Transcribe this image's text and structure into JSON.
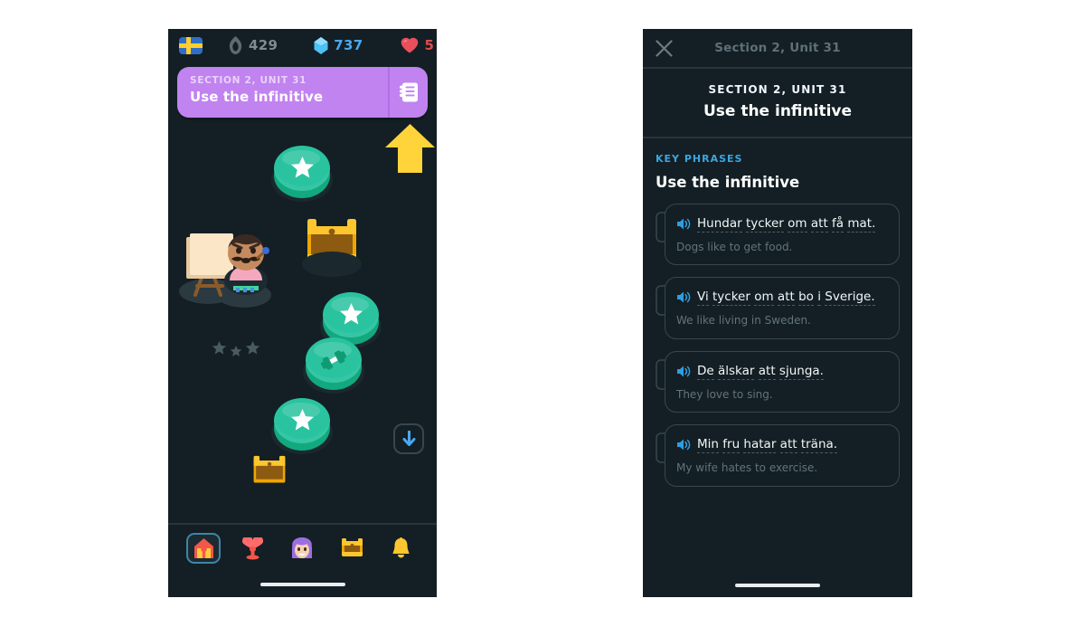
{
  "left_phone": {
    "status_bar": {
      "flag": {
        "icon": "swedish-flag-icon",
        "alt": "Swedish flag"
      },
      "streak": {
        "icon": "flame-icon",
        "value": "429"
      },
      "gems": {
        "icon": "gem-icon",
        "value": "737"
      },
      "hearts": {
        "icon": "heart-icon",
        "value": "5"
      }
    },
    "unit_banner": {
      "subtitle": "SECTION 2, UNIT 31",
      "title": "Use the infinitive",
      "guidebook_icon": "notebook-icon",
      "color": "#c183f0"
    },
    "pointer_arrow": {
      "icon": "up-arrow-icon",
      "color": "#ffd43b"
    },
    "path_nodes": [
      {
        "name": "lesson-node-star-1",
        "glyph": "star-icon",
        "state": "active"
      },
      {
        "name": "chest-node-1",
        "glyph": "treasure-chest-icon",
        "state": "locked"
      },
      {
        "name": "lesson-node-star-2",
        "glyph": "star-icon",
        "state": "locked"
      },
      {
        "name": "lesson-node-dumbbell",
        "glyph": "dumbbell-icon",
        "state": "locked"
      },
      {
        "name": "lesson-node-star-3",
        "glyph": "star-icon",
        "state": "locked"
      },
      {
        "name": "chest-node-2",
        "glyph": "treasure-chest-icon",
        "state": "locked"
      }
    ],
    "mascot": {
      "name": "painter-character",
      "alt": "character at easel"
    },
    "jump_button": {
      "icon": "down-arrow-icon",
      "color": "#49a8f2"
    },
    "nav_items": [
      {
        "name": "nav-learn",
        "icon": "home-icon",
        "active": true
      },
      {
        "name": "nav-practice",
        "icon": "heart-dumbbell-icon",
        "active": false
      },
      {
        "name": "nav-profile",
        "icon": "avatar-icon",
        "active": false
      },
      {
        "name": "nav-quests",
        "icon": "chest-icon",
        "active": false
      },
      {
        "name": "nav-leaderboard",
        "icon": "bell-icon",
        "active": false
      }
    ]
  },
  "right_phone": {
    "topbar": {
      "close_icon": "close-icon",
      "title": "Section 2, Unit 31"
    },
    "header": {
      "subtitle": "SECTION 2, UNIT 31",
      "title": "Use the infinitive"
    },
    "key_phrases_label": "KEY PHRASES",
    "key_phrases_title": "Use the infinitive",
    "phrases": [
      {
        "name": "phrase-card-1",
        "speaker_icon": "speaker-icon",
        "target": "Hundar tycker om att få mat.",
        "target_words": [
          "Hundar",
          "tycker",
          "om",
          "att",
          "få",
          "mat."
        ],
        "translation": "Dogs like to get food."
      },
      {
        "name": "phrase-card-2",
        "speaker_icon": "speaker-icon",
        "target": "Vi tycker om att bo  i Sverige.",
        "target_words": [
          "Vi",
          "tycker",
          "om",
          "att",
          "bo",
          "i",
          "Sverige."
        ],
        "translation": "We like living in Sweden."
      },
      {
        "name": "phrase-card-3",
        "speaker_icon": "speaker-icon",
        "target": "De älskar att sjunga.",
        "target_words": [
          "De",
          "älskar",
          "att",
          "sjunga."
        ],
        "translation": "They love to sing."
      },
      {
        "name": "phrase-card-4",
        "speaker_icon": "speaker-icon",
        "target": "Min fru hatar att träna.",
        "target_words": [
          "Min",
          "fru",
          "hatar",
          "att",
          "träna."
        ],
        "translation": "My wife hates to exercise."
      }
    ]
  },
  "colors": {
    "background": "#ffffff",
    "screen_bg": "#131f24",
    "accent_purple": "#c183f0",
    "accent_blue": "#49a8f2",
    "accent_green": "#2ac3a0",
    "accent_yellow": "#ffd43b",
    "heart_red": "#e04a4a",
    "muted_text": "#63737c"
  }
}
